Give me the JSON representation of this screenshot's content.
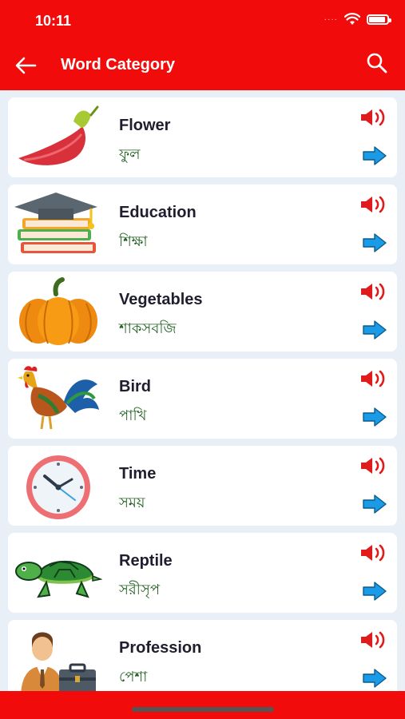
{
  "status_bar": {
    "time": "10:11",
    "dots": "····",
    "icons": [
      "wifi-icon",
      "battery-icon"
    ]
  },
  "header": {
    "title": "Word Category",
    "back_icon": "arrow-left-icon",
    "search_icon": "search-icon"
  },
  "colors": {
    "primary": "#f20b0b",
    "background": "#e9eff7",
    "card": "#ffffff",
    "bangla_text": "#1f5f1f",
    "arrow": "#1a9be8",
    "speaker": "#e11b1b"
  },
  "categories": [
    {
      "name": "Flower",
      "bangla": "ফুল",
      "icon": "flower-image"
    },
    {
      "name": "Education",
      "bangla": "শিক্ষা",
      "icon": "education-image"
    },
    {
      "name": "Vegetables",
      "bangla": "শাকসবজি",
      "icon": "pumpkin-image"
    },
    {
      "name": "Bird",
      "bangla": "পাখি",
      "icon": "rooster-image"
    },
    {
      "name": "Time",
      "bangla": "সময়",
      "icon": "clock-image"
    },
    {
      "name": "Reptile",
      "bangla": "সরীসৃপ",
      "icon": "turtle-image"
    },
    {
      "name": "Profession",
      "bangla": "পেশা",
      "icon": "profession-image"
    }
  ]
}
